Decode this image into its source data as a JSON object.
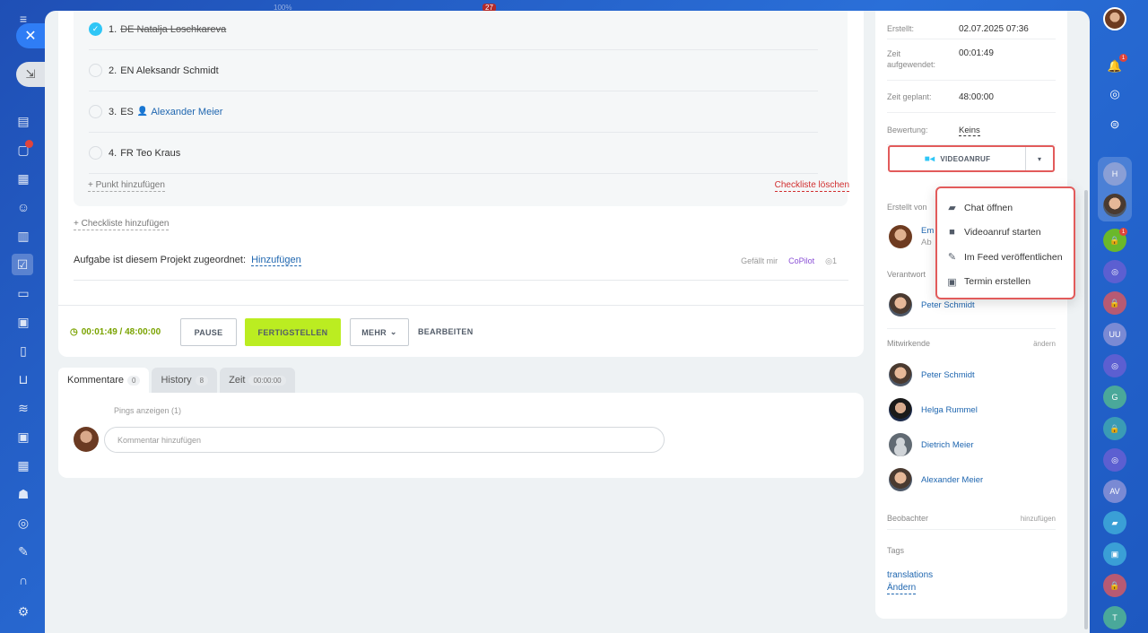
{
  "top_fragments": {
    "zoom": "100%",
    "badge": "27"
  },
  "checklist": {
    "items": [
      {
        "num": "1.",
        "text": "DE Natalja Loschkareva",
        "done": true
      },
      {
        "num": "2.",
        "text": "EN Aleksandr Schmidt",
        "done": false
      },
      {
        "num": "3.",
        "text": "ES",
        "user": "Alexander Meier",
        "done": false
      },
      {
        "num": "4.",
        "text": "FR Teo Kraus",
        "done": false
      }
    ],
    "add_point": "+ Punkt hinzufügen",
    "delete": "Checkliste löschen",
    "add_checklist": "+ Checkliste hinzufügen"
  },
  "project": {
    "label": "Aufgabe ist diesem Projekt zugeordnet:",
    "link": "Hinzufügen"
  },
  "likes": {
    "like": "Gefällt mir",
    "copilot": "CoPilot",
    "views": "1"
  },
  "actions": {
    "timer": "00:01:49 / 48:00:00",
    "pause": "PAUSE",
    "finish": "FERTIGSTELLEN",
    "more": "MEHR",
    "edit": "BEARBEITEN"
  },
  "tabs": [
    {
      "label": "Kommentare",
      "count": "0"
    },
    {
      "label": "History",
      "count": "8"
    },
    {
      "label": "Zeit",
      "count": "00:00:00"
    }
  ],
  "comments": {
    "pings": "Pings anzeigen (1)",
    "placeholder": "Kommentar hinzufügen"
  },
  "details": {
    "created_label": "Erstellt:",
    "created_value": "02.07.2025 07:36",
    "spent_label": "Zeit aufgewendet:",
    "spent_value": "00:01:49",
    "planned_label": "Zeit geplant:",
    "planned_value": "48:00:00",
    "rating_label": "Bewertung:",
    "rating_value": "Keins"
  },
  "video_button": "VIDEOANRUF",
  "menu": [
    {
      "icon": "chat-icon",
      "label": "Chat öffnen"
    },
    {
      "icon": "video-camera-icon",
      "label": "Videoanruf starten"
    },
    {
      "icon": "edit-icon",
      "label": "Im Feed veröffentlichen"
    },
    {
      "icon": "calendar-icon",
      "label": "Termin erstellen"
    }
  ],
  "created_by": {
    "label": "Erstellt von",
    "name_fragment": "Em",
    "sub_fragment": "Ab"
  },
  "responsible": {
    "label": "Verantwort",
    "name": "Peter Schmidt"
  },
  "participants": {
    "label": "Mitwirkende",
    "change": "ändern",
    "people": [
      "Peter Schmidt",
      "Helga Rummel",
      "Dietrich Meier",
      "Alexander Meier"
    ]
  },
  "observers": {
    "label": "Beobachter",
    "add": "hinzufügen"
  },
  "tags": {
    "label": "Tags",
    "value": "translations",
    "change": "Ändern"
  },
  "right_bar": {
    "notif_badge": "1",
    "lock_badge": "1",
    "initials": [
      "H",
      "G",
      "AV",
      "T",
      "UU"
    ],
    "colors": {
      "accent": "#2fc6f6",
      "green": "#bbed21",
      "danger": "#e25b5b"
    }
  }
}
